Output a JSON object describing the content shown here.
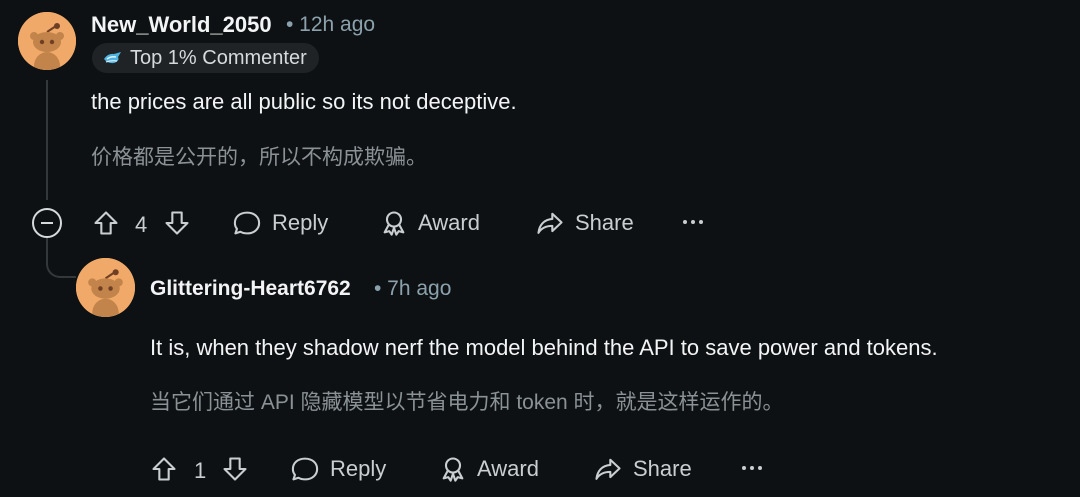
{
  "comments": [
    {
      "username": "New_World_2050",
      "time": "• 12h ago",
      "flair": "Top 1% Commenter",
      "text": "the prices are all public so its not deceptive.",
      "translation": "价格都是公开的，所以不构成欺骗。",
      "votes": "4",
      "actions": {
        "reply": "Reply",
        "award": "Award",
        "share": "Share"
      }
    },
    {
      "username": "Glittering-Heart6762",
      "time": "• 7h ago",
      "text": "It is, when they shadow nerf the model behind the API to save power and tokens.",
      "translation": "当它们通过 API 隐藏模型以节省电力和 token 时，就是这样运作的。",
      "votes": "1",
      "actions": {
        "reply": "Reply",
        "award": "Award",
        "share": "Share"
      }
    }
  ],
  "colors": {
    "background": "#0e1113",
    "avatar": "#f0a968",
    "muted_text": "#8ba2ad",
    "translation_text": "#8a9296"
  },
  "icons": [
    "avatar-snoo-icon",
    "flair-badge-icon",
    "collapse-icon",
    "upvote-icon",
    "downvote-icon",
    "comment-bubble-icon",
    "award-icon",
    "share-arrow-icon",
    "more-options-icon"
  ]
}
